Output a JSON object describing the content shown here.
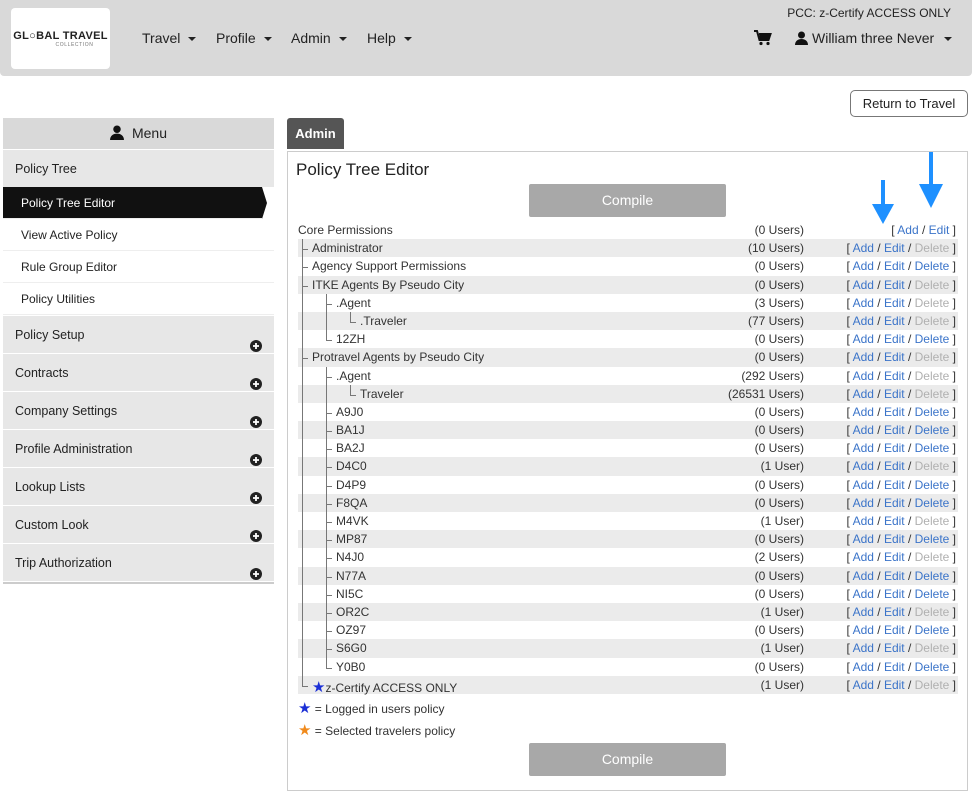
{
  "header": {
    "logo_main": "GL○BAL TRAVEL",
    "logo_sub": "COLLECTION",
    "nav": [
      "Travel",
      "Profile",
      "Admin",
      "Help"
    ],
    "pcc": "PCC: z-Certify ACCESS ONLY",
    "user_name": "William three Never",
    "icons": {
      "cart": "cart-icon",
      "user": "user-icon"
    }
  },
  "return_button": "Return to Travel",
  "sidebar": {
    "menu_label": "Menu",
    "sections": [
      {
        "label": "Policy Tree",
        "expanded": true,
        "items": [
          "Policy Tree Editor",
          "View Active Policy",
          "Rule Group Editor",
          "Policy Utilities"
        ],
        "active_item": "Policy Tree Editor"
      },
      {
        "label": "Policy Setup"
      },
      {
        "label": "Contracts"
      },
      {
        "label": "Company Settings"
      },
      {
        "label": "Profile Administration"
      },
      {
        "label": "Lookup Lists"
      },
      {
        "label": "Custom Look"
      },
      {
        "label": "Trip Authorization"
      }
    ]
  },
  "admin_tab": "Admin",
  "panel": {
    "title": "Policy Tree Editor",
    "compile_label": "Compile",
    "actions": {
      "add": "Add",
      "edit": "Edit",
      "delete": "Delete"
    },
    "rows": [
      {
        "name": "Core Permissions",
        "users": "(0 Users)",
        "level": 0,
        "edit_enabled": true,
        "delete_enabled": false,
        "has_delete": false
      },
      {
        "name": "Administrator",
        "users": "(10 Users)",
        "level": 1,
        "edit_enabled": true,
        "delete_enabled": false
      },
      {
        "name": "Agency Support Permissions",
        "users": "(0 Users)",
        "level": 1,
        "edit_enabled": true,
        "delete_enabled": true
      },
      {
        "name": "ITKE Agents By Pseudo City",
        "users": "(0 Users)",
        "level": 1,
        "edit_enabled": false,
        "delete_enabled": false
      },
      {
        "name": ".Agent",
        "users": "(3 Users)",
        "level": 2,
        "edit_enabled": false,
        "delete_enabled": false
      },
      {
        "name": ".Traveler",
        "users": "(77 Users)",
        "level": 3,
        "edit_enabled": false,
        "delete_enabled": false
      },
      {
        "name": "12ZH",
        "users": "(0 Users)",
        "level": 2,
        "edit_enabled": true,
        "delete_enabled": true
      },
      {
        "name": "Protravel Agents by Pseudo City",
        "users": "(0 Users)",
        "level": 1,
        "edit_enabled": false,
        "delete_enabled": false
      },
      {
        "name": ".Agent",
        "users": "(292 Users)",
        "level": 2,
        "edit_enabled": false,
        "delete_enabled": false
      },
      {
        "name": "Traveler",
        "users": "(26531 Users)",
        "level": 3,
        "edit_enabled": false,
        "delete_enabled": false
      },
      {
        "name": "A9J0",
        "users": "(0 Users)",
        "level": 2,
        "edit_enabled": true,
        "delete_enabled": true
      },
      {
        "name": "BA1J",
        "users": "(0 Users)",
        "level": 2,
        "edit_enabled": true,
        "delete_enabled": true
      },
      {
        "name": "BA2J",
        "users": "(0 Users)",
        "level": 2,
        "edit_enabled": true,
        "delete_enabled": true
      },
      {
        "name": "D4C0",
        "users": "(1 User)",
        "level": 2,
        "edit_enabled": true,
        "delete_enabled": false
      },
      {
        "name": "D4P9",
        "users": "(0 Users)",
        "level": 2,
        "edit_enabled": true,
        "delete_enabled": true
      },
      {
        "name": "F8QA",
        "users": "(0 Users)",
        "level": 2,
        "edit_enabled": true,
        "delete_enabled": true
      },
      {
        "name": "M4VK",
        "users": "(1 User)",
        "level": 2,
        "edit_enabled": true,
        "delete_enabled": false
      },
      {
        "name": "MP87",
        "users": "(0 Users)",
        "level": 2,
        "edit_enabled": true,
        "delete_enabled": true
      },
      {
        "name": "N4J0",
        "users": "(2 Users)",
        "level": 2,
        "edit_enabled": true,
        "delete_enabled": false
      },
      {
        "name": "N77A",
        "users": "(0 Users)",
        "level": 2,
        "edit_enabled": true,
        "delete_enabled": true
      },
      {
        "name": "NI5C",
        "users": "(0 Users)",
        "level": 2,
        "edit_enabled": true,
        "delete_enabled": true
      },
      {
        "name": "OR2C",
        "users": "(1 User)",
        "level": 2,
        "edit_enabled": true,
        "delete_enabled": false
      },
      {
        "name": "OZ97",
        "users": "(0 Users)",
        "level": 2,
        "edit_enabled": true,
        "delete_enabled": true
      },
      {
        "name": "S6G0",
        "users": "(1 User)",
        "level": 2,
        "edit_enabled": true,
        "delete_enabled": false
      },
      {
        "name": "Y0B0",
        "users": "(0 Users)",
        "level": 2,
        "edit_enabled": true,
        "delete_enabled": true
      },
      {
        "name": "z-Certify ACCESS ONLY",
        "users": "(1 User)",
        "level": 1,
        "edit_enabled": true,
        "delete_enabled": false,
        "starred": true
      }
    ],
    "legend": {
      "logged_in": "= Logged in users policy",
      "selected": "= Selected travelers policy"
    },
    "colors": {
      "link": "#3b74c9",
      "disabled": "#b0b0b0",
      "arrow": "#1e90ff",
      "star_blue": "#1b2fd6",
      "star_orange": "#f08a1c"
    }
  }
}
